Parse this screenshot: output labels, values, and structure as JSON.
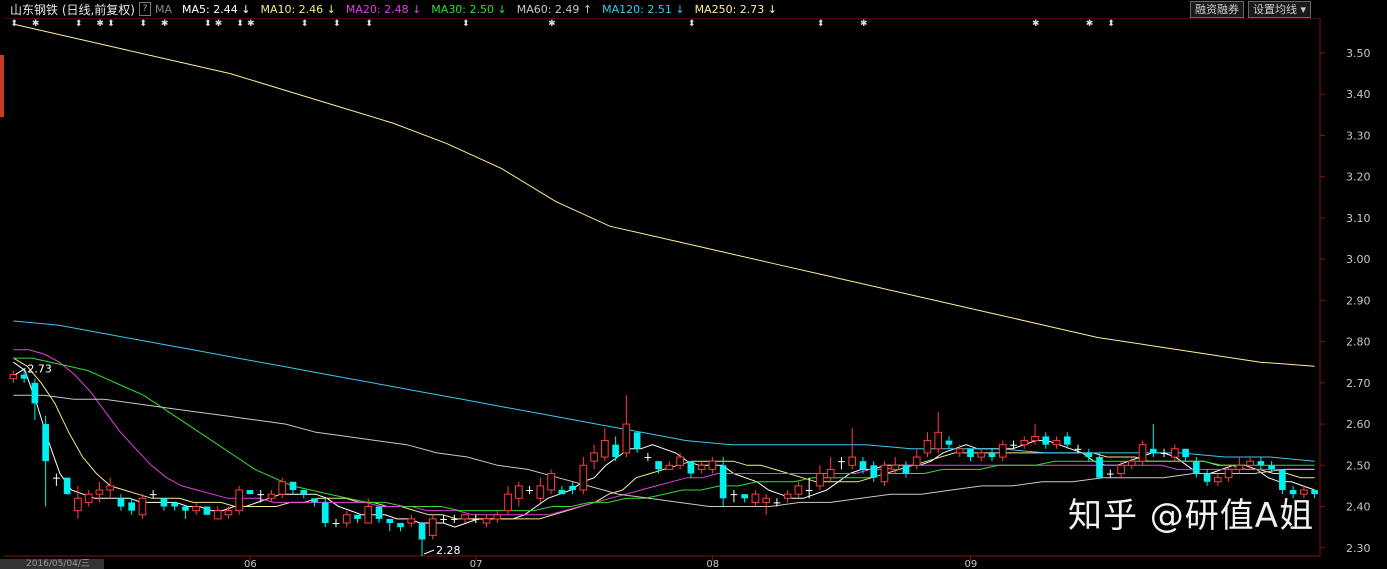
{
  "header": {
    "title": "山东钢铁 (日线,前复权)",
    "help": "?",
    "ma_label": "MA",
    "ma_items": [
      {
        "label": "MA5: 2.44 ↓",
        "color": "#ffffff"
      },
      {
        "label": "MA10: 2.46 ↓",
        "color": "#f3e98a"
      },
      {
        "label": "MA20: 2.48 ↓",
        "color": "#e040e0"
      },
      {
        "label": "MA30: 2.50 ↓",
        "color": "#33dd33"
      },
      {
        "label": "MA60: 2.49 ↑",
        "color": "#c8c8c8"
      },
      {
        "label": "MA120: 2.51 ↓",
        "color": "#3cc8f0"
      },
      {
        "label": "MA250: 2.73 ↓",
        "color": "#ffee99"
      }
    ],
    "btn_margin": "融资融券",
    "btn_ma": "设置均线 ▾"
  },
  "footer": {
    "date_tab": "2016/05/04/三"
  },
  "watermark": "知乎 @研值A姐",
  "chart_data": {
    "type": "candlestick",
    "ylim": [
      2.28,
      3.58
    ],
    "yticks": [
      "3.50",
      "3.40",
      "3.30",
      "3.20",
      "3.10",
      "3.00",
      "2.90",
      "2.80",
      "2.70",
      "2.60",
      "2.50",
      "2.40",
      "2.30"
    ],
    "month_labels": [
      {
        "label": "06",
        "index": 22
      },
      {
        "label": "07",
        "index": 43
      },
      {
        "label": "08",
        "index": 65
      },
      {
        "label": "09",
        "index": 89
      }
    ],
    "annotations": [
      {
        "label": "2.73",
        "index": 0,
        "value": 2.73
      },
      {
        "label": "2.28",
        "index": 38,
        "value": 2.28
      }
    ],
    "candles": [
      [
        2.71,
        2.72,
        2.73,
        2.7
      ],
      [
        2.72,
        2.71,
        2.73,
        2.7
      ],
      [
        2.7,
        2.65,
        2.71,
        2.61
      ],
      [
        2.6,
        2.51,
        2.62,
        2.4
      ],
      [
        2.47,
        2.47,
        2.48,
        2.45
      ],
      [
        2.47,
        2.43,
        2.47,
        2.43
      ],
      [
        2.39,
        2.42,
        2.45,
        2.37
      ],
      [
        2.41,
        2.43,
        2.44,
        2.4
      ],
      [
        2.43,
        2.44,
        2.46,
        2.41
      ],
      [
        2.44,
        2.45,
        2.47,
        2.42
      ],
      [
        2.42,
        2.4,
        2.43,
        2.39
      ],
      [
        2.41,
        2.39,
        2.42,
        2.38
      ],
      [
        2.38,
        2.42,
        2.43,
        2.37
      ],
      [
        2.43,
        2.43,
        2.44,
        2.42
      ],
      [
        2.42,
        2.4,
        2.42,
        2.39
      ],
      [
        2.41,
        2.4,
        2.41,
        2.39
      ],
      [
        2.4,
        2.39,
        2.4,
        2.37
      ],
      [
        2.39,
        2.4,
        2.41,
        2.38
      ],
      [
        2.4,
        2.38,
        2.4,
        2.38
      ],
      [
        2.37,
        2.39,
        2.4,
        2.37
      ],
      [
        2.38,
        2.39,
        2.4,
        2.37
      ],
      [
        2.39,
        2.44,
        2.45,
        2.38
      ],
      [
        2.44,
        2.43,
        2.44,
        2.43
      ],
      [
        2.43,
        2.43,
        2.44,
        2.41
      ],
      [
        2.42,
        2.43,
        2.44,
        2.41
      ],
      [
        2.43,
        2.46,
        2.47,
        2.42
      ],
      [
        2.46,
        2.44,
        2.46,
        2.43
      ],
      [
        2.44,
        2.43,
        2.44,
        2.42
      ],
      [
        2.42,
        2.41,
        2.42,
        2.4
      ],
      [
        2.41,
        2.36,
        2.42,
        2.35
      ],
      [
        2.36,
        2.36,
        2.37,
        2.35
      ],
      [
        2.36,
        2.38,
        2.39,
        2.35
      ],
      [
        2.38,
        2.37,
        2.38,
        2.36
      ],
      [
        2.36,
        2.4,
        2.42,
        2.36
      ],
      [
        2.4,
        2.37,
        2.4,
        2.36
      ],
      [
        2.37,
        2.36,
        2.37,
        2.34
      ],
      [
        2.36,
        2.35,
        2.36,
        2.34
      ],
      [
        2.36,
        2.37,
        2.38,
        2.35
      ],
      [
        2.36,
        2.32,
        2.36,
        2.28
      ],
      [
        2.33,
        2.37,
        2.38,
        2.32
      ],
      [
        2.37,
        2.37,
        2.38,
        2.36
      ],
      [
        2.37,
        2.37,
        2.38,
        2.36
      ],
      [
        2.37,
        2.38,
        2.38,
        2.36
      ],
      [
        2.37,
        2.37,
        2.38,
        2.36
      ],
      [
        2.36,
        2.37,
        2.38,
        2.35
      ],
      [
        2.37,
        2.38,
        2.39,
        2.36
      ],
      [
        2.39,
        2.43,
        2.45,
        2.38
      ],
      [
        2.42,
        2.45,
        2.46,
        2.4
      ],
      [
        2.44,
        2.44,
        2.45,
        2.43
      ],
      [
        2.42,
        2.45,
        2.47,
        2.41
      ],
      [
        2.44,
        2.48,
        2.49,
        2.43
      ],
      [
        2.44,
        2.43,
        2.45,
        2.43
      ],
      [
        2.45,
        2.44,
        2.46,
        2.43
      ],
      [
        2.44,
        2.5,
        2.52,
        2.43
      ],
      [
        2.51,
        2.53,
        2.55,
        2.49
      ],
      [
        2.52,
        2.56,
        2.59,
        2.51
      ],
      [
        2.55,
        2.52,
        2.57,
        2.51
      ],
      [
        2.53,
        2.6,
        2.67,
        2.52
      ],
      [
        2.58,
        2.54,
        2.58,
        2.53
      ],
      [
        2.52,
        2.52,
        2.53,
        2.51
      ],
      [
        2.51,
        2.49,
        2.51,
        2.48
      ],
      [
        2.49,
        2.5,
        2.51,
        2.49
      ],
      [
        2.5,
        2.52,
        2.53,
        2.49
      ],
      [
        2.51,
        2.48,
        2.51,
        2.47
      ],
      [
        2.49,
        2.5,
        2.51,
        2.48
      ],
      [
        2.49,
        2.51,
        2.52,
        2.48
      ],
      [
        2.5,
        2.42,
        2.52,
        2.4
      ],
      [
        2.43,
        2.43,
        2.44,
        2.41
      ],
      [
        2.43,
        2.42,
        2.43,
        2.41
      ],
      [
        2.41,
        2.43,
        2.44,
        2.4
      ],
      [
        2.41,
        2.42,
        2.43,
        2.38
      ],
      [
        2.41,
        2.41,
        2.42,
        2.4
      ],
      [
        2.42,
        2.43,
        2.44,
        2.41
      ],
      [
        2.43,
        2.45,
        2.46,
        2.42
      ],
      [
        2.44,
        2.44,
        2.47,
        2.42
      ],
      [
        2.45,
        2.48,
        2.5,
        2.44
      ],
      [
        2.47,
        2.49,
        2.52,
        2.46
      ],
      [
        2.51,
        2.51,
        2.52,
        2.49
      ],
      [
        2.5,
        2.52,
        2.59,
        2.49
      ],
      [
        2.51,
        2.49,
        2.52,
        2.48
      ],
      [
        2.5,
        2.47,
        2.51,
        2.46
      ],
      [
        2.46,
        2.5,
        2.51,
        2.45
      ],
      [
        2.49,
        2.5,
        2.52,
        2.48
      ],
      [
        2.5,
        2.48,
        2.51,
        2.47
      ],
      [
        2.5,
        2.52,
        2.54,
        2.49
      ],
      [
        2.53,
        2.56,
        2.58,
        2.52
      ],
      [
        2.54,
        2.58,
        2.63,
        2.53
      ],
      [
        2.56,
        2.55,
        2.57,
        2.54
      ],
      [
        2.53,
        2.54,
        2.55,
        2.52
      ],
      [
        2.54,
        2.52,
        2.54,
        2.51
      ],
      [
        2.52,
        2.53,
        2.54,
        2.51
      ],
      [
        2.53,
        2.52,
        2.54,
        2.51
      ],
      [
        2.52,
        2.55,
        2.56,
        2.51
      ],
      [
        2.55,
        2.55,
        2.56,
        2.54
      ],
      [
        2.55,
        2.56,
        2.57,
        2.54
      ],
      [
        2.56,
        2.57,
        2.6,
        2.55
      ],
      [
        2.57,
        2.55,
        2.58,
        2.54
      ],
      [
        2.55,
        2.56,
        2.57,
        2.54
      ],
      [
        2.57,
        2.55,
        2.58,
        2.54
      ],
      [
        2.54,
        2.54,
        2.55,
        2.53
      ],
      [
        2.53,
        2.52,
        2.54,
        2.51
      ],
      [
        2.52,
        2.47,
        2.53,
        2.47
      ],
      [
        2.48,
        2.48,
        2.49,
        2.47
      ],
      [
        2.48,
        2.5,
        2.51,
        2.47
      ],
      [
        2.5,
        2.51,
        2.52,
        2.49
      ],
      [
        2.51,
        2.55,
        2.56,
        2.5
      ],
      [
        2.54,
        2.53,
        2.6,
        2.52
      ],
      [
        2.53,
        2.53,
        2.54,
        2.52
      ],
      [
        2.52,
        2.54,
        2.55,
        2.51
      ],
      [
        2.54,
        2.52,
        2.54,
        2.51
      ],
      [
        2.51,
        2.48,
        2.52,
        2.47
      ],
      [
        2.48,
        2.46,
        2.49,
        2.45
      ],
      [
        2.46,
        2.47,
        2.48,
        2.45
      ],
      [
        2.47,
        2.49,
        2.5,
        2.46
      ],
      [
        2.49,
        2.5,
        2.52,
        2.48
      ],
      [
        2.5,
        2.51,
        2.52,
        2.49
      ],
      [
        2.51,
        2.5,
        2.52,
        2.49
      ],
      [
        2.5,
        2.49,
        2.51,
        2.48
      ],
      [
        2.49,
        2.44,
        2.49,
        2.43
      ],
      [
        2.44,
        2.43,
        2.45,
        2.42
      ],
      [
        2.43,
        2.44,
        2.45,
        2.42
      ],
      [
        2.44,
        2.43,
        2.44,
        2.42
      ]
    ],
    "ma_series": [
      {
        "color": "#ffffff",
        "values": [
          2.75,
          2.73,
          2.65,
          2.56,
          2.48,
          2.44,
          2.43,
          2.42,
          2.42,
          2.42,
          2.42,
          2.41,
          2.41,
          2.41,
          2.41,
          2.4,
          2.4,
          2.39,
          2.39,
          2.4,
          2.4,
          2.41,
          2.42,
          2.43,
          2.43,
          2.43,
          2.43,
          2.42,
          2.4,
          2.39,
          2.38,
          2.38,
          2.38,
          2.37,
          2.37,
          2.36,
          2.36,
          2.36,
          2.35,
          2.36,
          2.37,
          2.37,
          2.37,
          2.37,
          2.38,
          2.4,
          2.42,
          2.43,
          2.44,
          2.46,
          2.47,
          2.5,
          2.52,
          2.54,
          2.54,
          2.55,
          2.54,
          2.53,
          2.51,
          2.5,
          2.5,
          2.5,
          2.48,
          2.47,
          2.46,
          2.44,
          2.43,
          2.42,
          2.42,
          2.43,
          2.44,
          2.46,
          2.48,
          2.49,
          2.49,
          2.5,
          2.5,
          2.5,
          2.5,
          2.51,
          2.53,
          2.54,
          2.55,
          2.54,
          2.54,
          2.54,
          2.54,
          2.55,
          2.56,
          2.56,
          2.55,
          2.54,
          2.53,
          2.51,
          2.5,
          2.5,
          2.51,
          2.52,
          2.53,
          2.53,
          2.52,
          2.5,
          2.48,
          2.48,
          2.49,
          2.5,
          2.5,
          2.49,
          2.47,
          2.46,
          2.46,
          2.45,
          2.44
        ]
      },
      {
        "color": "#f3e98a",
        "values": [
          2.76,
          2.74,
          2.7,
          2.65,
          2.58,
          2.52,
          2.48,
          2.45,
          2.44,
          2.43,
          2.42,
          2.42,
          2.42,
          2.41,
          2.41,
          2.41,
          2.4,
          2.4,
          2.4,
          2.4,
          2.41,
          2.41,
          2.42,
          2.42,
          2.42,
          2.41,
          2.41,
          2.4,
          2.4,
          2.39,
          2.38,
          2.38,
          2.37,
          2.37,
          2.37,
          2.37,
          2.37,
          2.37,
          2.37,
          2.38,
          2.39,
          2.4,
          2.41,
          2.43,
          2.44,
          2.47,
          2.48,
          2.49,
          2.5,
          2.51,
          2.51,
          2.51,
          2.51,
          2.5,
          2.5,
          2.49,
          2.48,
          2.47,
          2.46,
          2.46,
          2.46,
          2.46,
          2.47,
          2.48,
          2.49,
          2.5,
          2.51,
          2.52,
          2.53,
          2.53,
          2.53,
          2.53,
          2.53,
          2.53,
          2.53,
          2.53,
          2.53,
          2.53,
          2.53,
          2.52,
          2.52,
          2.52,
          2.51,
          2.51,
          2.51,
          2.51,
          2.51,
          2.5,
          2.5,
          2.49,
          2.49,
          2.48,
          2.48,
          2.47,
          2.47
        ]
      },
      {
        "color": "#e040e0",
        "values": [
          2.78,
          2.78,
          2.77,
          2.75,
          2.72,
          2.68,
          2.63,
          2.58,
          2.54,
          2.5,
          2.47,
          2.45,
          2.44,
          2.43,
          2.42,
          2.42,
          2.42,
          2.41,
          2.41,
          2.41,
          2.41,
          2.41,
          2.41,
          2.41,
          2.4,
          2.4,
          2.4,
          2.39,
          2.39,
          2.39,
          2.38,
          2.38,
          2.38,
          2.38,
          2.38,
          2.38,
          2.39,
          2.4,
          2.41,
          2.42,
          2.43,
          2.44,
          2.45,
          2.46,
          2.47,
          2.47,
          2.48,
          2.48,
          2.48,
          2.48,
          2.48,
          2.48,
          2.48,
          2.48,
          2.48,
          2.48,
          2.49,
          2.49,
          2.5,
          2.5,
          2.5,
          2.5,
          2.5,
          2.5,
          2.5,
          2.5,
          2.5,
          2.5,
          2.5,
          2.5,
          2.5,
          2.5,
          2.5,
          2.5,
          2.5,
          2.5,
          2.49,
          2.49,
          2.49,
          2.49,
          2.49,
          2.49,
          2.49,
          2.49,
          2.49,
          2.49
        ]
      },
      {
        "color": "#33dd33",
        "values": [
          2.76,
          2.76,
          2.75,
          2.74,
          2.73,
          2.71,
          2.69,
          2.67,
          2.64,
          2.61,
          2.58,
          2.55,
          2.52,
          2.49,
          2.47,
          2.45,
          2.44,
          2.43,
          2.42,
          2.41,
          2.41,
          2.4,
          2.4,
          2.4,
          2.39,
          2.39,
          2.39,
          2.39,
          2.39,
          2.4,
          2.4,
          2.41,
          2.41,
          2.42,
          2.42,
          2.43,
          2.44,
          2.44,
          2.45,
          2.45,
          2.46,
          2.46,
          2.46,
          2.47,
          2.47,
          2.47,
          2.47,
          2.48,
          2.48,
          2.48,
          2.49,
          2.49,
          2.49,
          2.5,
          2.5,
          2.5,
          2.51,
          2.51,
          2.51,
          2.51,
          2.51,
          2.51,
          2.51,
          2.51,
          2.51,
          2.5,
          2.5,
          2.5,
          2.5,
          2.5,
          2.5
        ]
      },
      {
        "color": "#c8c8c8",
        "values": [
          2.67,
          2.67,
          2.66,
          2.66,
          2.65,
          2.64,
          2.63,
          2.62,
          2.61,
          2.6,
          2.58,
          2.57,
          2.56,
          2.55,
          2.53,
          2.52,
          2.5,
          2.49,
          2.47,
          2.45,
          2.43,
          2.42,
          2.41,
          2.4,
          2.4,
          2.4,
          2.41,
          2.41,
          2.42,
          2.43,
          2.43,
          2.44,
          2.45,
          2.45,
          2.46,
          2.46,
          2.47,
          2.47,
          2.47,
          2.48,
          2.48,
          2.48,
          2.49,
          2.49
        ]
      },
      {
        "color": "#3cc8f0",
        "values": [
          2.85,
          2.84,
          2.82,
          2.8,
          2.78,
          2.76,
          2.74,
          2.72,
          2.7,
          2.68,
          2.66,
          2.64,
          2.62,
          2.6,
          2.58,
          2.56,
          2.55,
          2.55,
          2.55,
          2.55,
          2.54,
          2.54,
          2.54,
          2.53,
          2.53,
          2.53,
          2.53,
          2.52,
          2.52,
          2.51
        ]
      },
      {
        "color": "#ffee99",
        "values": [
          3.57,
          3.54,
          3.51,
          3.48,
          3.45,
          3.41,
          3.37,
          3.33,
          3.28,
          3.22,
          3.14,
          3.08,
          3.05,
          3.02,
          2.99,
          2.96,
          2.93,
          2.9,
          2.87,
          2.84,
          2.81,
          2.79,
          2.77,
          2.75,
          2.74
        ]
      }
    ]
  }
}
